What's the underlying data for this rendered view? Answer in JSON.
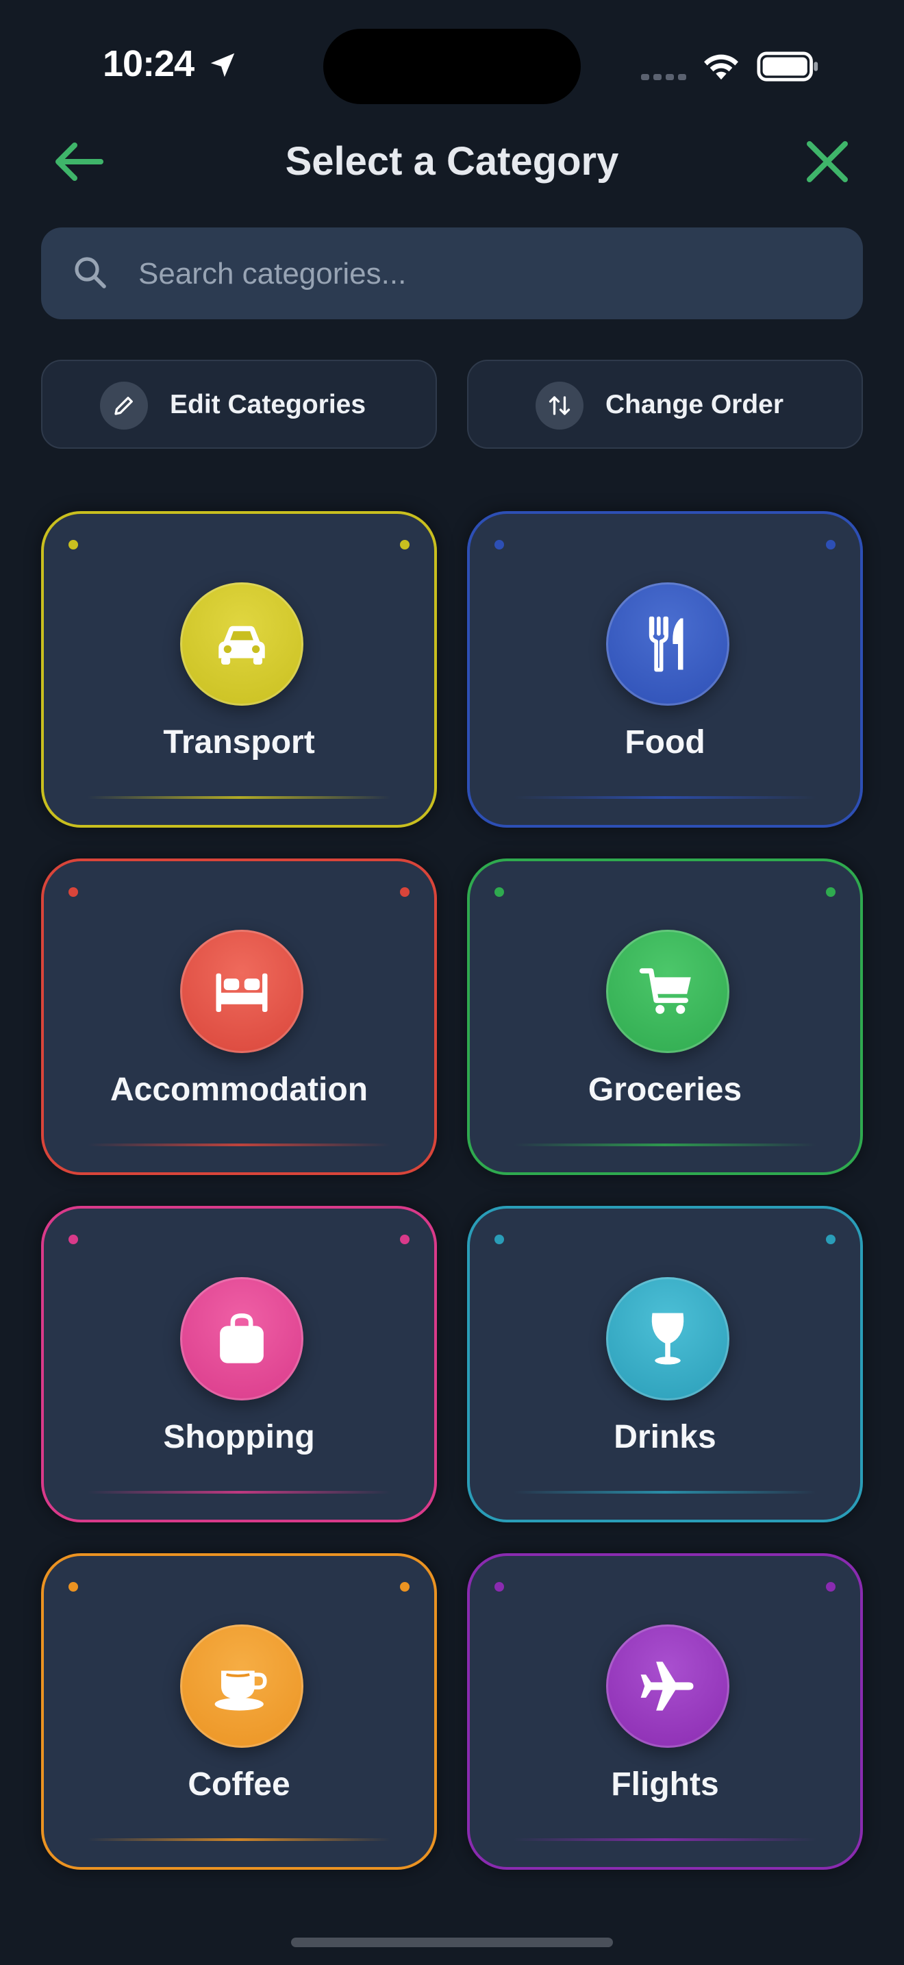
{
  "status_bar": {
    "time": "10:24"
  },
  "header": {
    "title": "Select a Category"
  },
  "search": {
    "placeholder": "Search categories..."
  },
  "actions": {
    "edit_label": "Edit Categories",
    "order_label": "Change Order"
  },
  "categories": [
    {
      "label": "Transport",
      "icon": "car-icon",
      "color": "#c9bf1f"
    },
    {
      "label": "Food",
      "icon": "utensils-icon",
      "color": "#2d4fb5"
    },
    {
      "label": "Accommodation",
      "icon": "bed-icon",
      "color": "#d9453a"
    },
    {
      "label": "Groceries",
      "icon": "shopping-cart-icon",
      "color": "#2faa4f"
    },
    {
      "label": "Shopping",
      "icon": "shopping-bag-icon",
      "color": "#d93a8a"
    },
    {
      "label": "Drinks",
      "icon": "wine-glass-icon",
      "color": "#2a9db8"
    },
    {
      "label": "Coffee",
      "icon": "coffee-cup-icon",
      "color": "#eb9322"
    },
    {
      "label": "Flights",
      "icon": "airplane-icon",
      "color": "#8a2bb0"
    }
  ]
}
